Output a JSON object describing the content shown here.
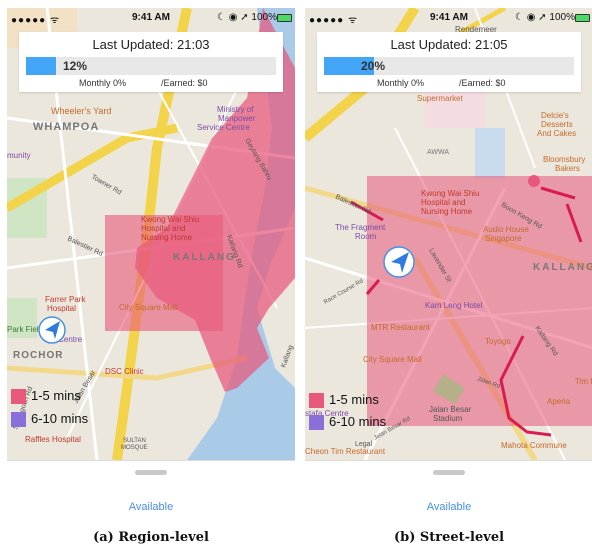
{
  "panel_a": {
    "status": {
      "signal": "●●●●● ᯤ",
      "time": "9:41 AM",
      "right": "☾ ◉ ➚ 100%"
    },
    "last_updated": "Last Updated: 21:03",
    "progress": {
      "fraction": 0.12,
      "label": "12%"
    },
    "monthly": "Monthly  0%",
    "earned": "/Earned:  $0",
    "legend": [
      {
        "label": "1-5 mins",
        "color": "#e8587a"
      },
      {
        "label": "6-10 mins",
        "color": "#8b6fd9"
      }
    ],
    "available": "Available",
    "map_labels": {
      "l1": "Wheeler's Yard",
      "l2": "WHAMPOA",
      "l3": "Ministry of",
      "l4": "Manpower",
      "l5": "Service Centre",
      "l6": "Geylang Bahru",
      "l7": "munity",
      "l8": "Kwong Wai Shiu",
      "l9": "Hospital and",
      "l10": "Nursing Home",
      "l11": "KALLANG",
      "l12": "Farrer Park",
      "l13": "Hospital",
      "l14": "City Square Mall",
      "l15": "Park Field",
      "l16": "ROCHOR",
      "l17": "DSC Clinic",
      "l18": "Raffles Hospital",
      "l19": "SULTAN",
      "l20": "MOSQUE",
      "l21": "Balestier Rd",
      "l22": "Towner Rd",
      "l23": "Kallang Rd",
      "l24": "ge Centre",
      "l25": "Jalan Besar",
      "l26": "Serangoon Rd",
      "l27": "Kallang"
    },
    "caption": "(a) Region-level"
  },
  "panel_b": {
    "status": {
      "signal": "●●●●● ᯤ",
      "time": "9:41 AM",
      "right": "☾ ◉ ➚ 100%"
    },
    "last_updated": "Last Updated: 21:05",
    "progress": {
      "fraction": 0.2,
      "label": "20%"
    },
    "monthly": "Monthly  0%",
    "earned": "/Earned:  $0",
    "legend": [
      {
        "label": "1-5 mins",
        "color": "#e8587a"
      },
      {
        "label": "6-10 mins",
        "color": "#8b6fd9"
      }
    ],
    "available": "Available",
    "map_labels": {
      "l1": "Rendemeer",
      "l2": "Supermarket",
      "l3": "AWWA",
      "l4": "Delcie's",
      "l5": "Desserts",
      "l6": "And Cakes",
      "l7": "Bloomsbury",
      "l8": "Bakers",
      "l9": "Kwong Wai Shiu",
      "l10": "Hospital and",
      "l11": "Nursing Home",
      "l12": "The Fragment",
      "l13": "Room",
      "l14": "Audio House",
      "l15": "Singapore",
      "l16": "KALLANG",
      "l17": "Kam Leng Hotel",
      "l18": "MTR Restaurant",
      "l19": "City Square Mall",
      "l20": "Toyogo",
      "l21": "Tim H",
      "l22": "Aperia",
      "l23": "Jalan Besar",
      "l24": "Stadium",
      "l25": "Mahota Commune",
      "l26": "Lavender St",
      "l27": "Boon Keng Rd",
      "l28": "Balestier Rd",
      "l29": "Kallang Rd",
      "l30": "stafa Centre",
      "l31": "Legal",
      "l32": "Cheon Tim Restaurant",
      "l33": "Jelan Besar Rd",
      "l34": "Race Course Rd",
      "l35": "Jalan Rd"
    },
    "caption": "(b) Street-level"
  }
}
